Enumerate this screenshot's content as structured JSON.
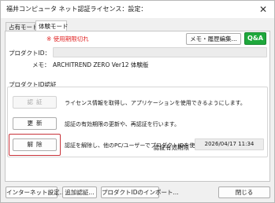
{
  "window": {
    "title": "福井コンピュータ ネット認証ライセンス：設定：",
    "close_glyph": "✕"
  },
  "tabs": [
    {
      "label": "占有モード",
      "selected": false
    },
    {
      "label": "体験モード",
      "selected": true
    }
  ],
  "status": {
    "expired": "※ 使用期限切れ"
  },
  "toolbar": {
    "memo_history_label": "メモ・履歴編集...",
    "qa_label": "Q&A"
  },
  "product": {
    "id_label": "プロダクトID：",
    "id_value": "",
    "memo_label": "メモ：",
    "memo_value": "ARCHITREND ZERO Ver12 体験版"
  },
  "auth_group": {
    "title": "プロダクトID認証",
    "actions": [
      {
        "label": "認証",
        "enabled": false,
        "description": "ライセンス情報を取得し、アプリケーションを使用できるようにします。"
      },
      {
        "label": "更新",
        "enabled": true,
        "description": "認証の有効期限の更新や、再認証を行います。"
      },
      {
        "label": "解除",
        "enabled": true,
        "description": "認証を解除し、他のPC/ユーザーでプロダクトIDを使用できるようにします。"
      }
    ],
    "expiry_label": "認証有効期限",
    "expiry_value": "2026/04/17 11:34"
  },
  "footer": {
    "internet_settings_label": "インターネット設定...",
    "add_auth_label": "追加認証...",
    "import_label": "プロダクトIDのインポート...",
    "close_label": "閉じる"
  },
  "colors": {
    "expired_text": "#e02424",
    "qa_button": "#1ea83c",
    "highlight_border": "#c8333a"
  }
}
